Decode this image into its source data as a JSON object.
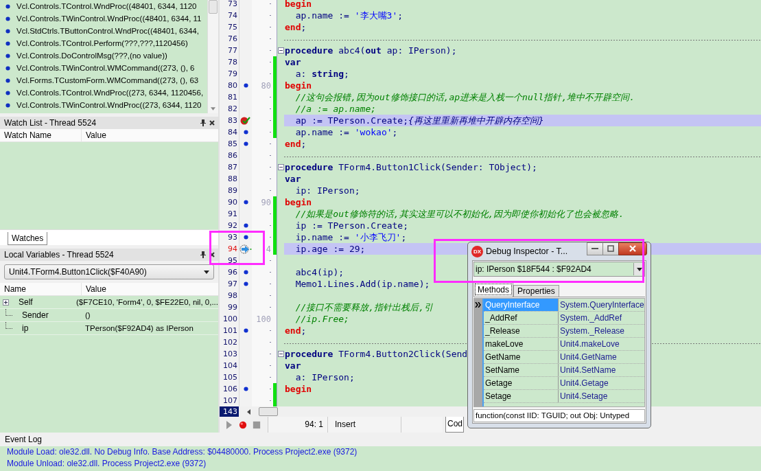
{
  "call_stack": {
    "items": [
      "Vcl.Controls.TControl.WndProc((48401, 6344, 1120",
      "Vcl.Controls.TWinControl.WndProc((48401, 6344, 11",
      "Vcl.StdCtrls.TButtonControl.WndProc((48401, 6344,",
      "Vcl.Controls.TControl.Perform(???,???,1120456)",
      "Vcl.Controls.DoControlMsg(???,(no value))",
      "Vcl.Controls.TWinControl.WMCommand((273, (), 6",
      "Vcl.Forms.TCustomForm.WMCommand((273, (), 63",
      "Vcl.Controls.TControl.WndProc((273, 6344, 1120456,",
      "Vcl.Controls.TWinControl.WndProc((273, 6344, 1120"
    ]
  },
  "watch_list": {
    "title": "Watch List - Thread 5524",
    "columns": [
      "Watch Name",
      "Value"
    ]
  },
  "bottom_tabs": [
    {
      "label": "Watches",
      "selected": true
    }
  ],
  "local_variables": {
    "title": "Local Variables - Thread 5524",
    "frame": "Unit4.TForm4.Button1Click($F40A90)",
    "columns": [
      "Name",
      "Value"
    ],
    "rows": [
      {
        "name": "Self",
        "value": "($F7CE10, 'Form4', 0, $FE22E0, nil, 0,...",
        "expanded": false
      },
      {
        "name": "Sender",
        "value": "()"
      },
      {
        "name": "ip",
        "value": "TPerson($F92AD4) as IPerson"
      }
    ]
  },
  "editor": {
    "lines": [
      {
        "number": "73",
        "modified": false,
        "highlighted": false,
        "tokens": [
          {
            "text": "begin",
            "kind": "block"
          }
        ]
      },
      {
        "number": "74",
        "modified": false,
        "highlighted": false,
        "tokens": [
          {
            "text": "  ap.name := ",
            "kind": "id"
          },
          {
            "text": "'李大嘴3'",
            "kind": "str"
          },
          {
            "text": ";",
            "kind": "id"
          }
        ]
      },
      {
        "number": "75",
        "modified": false,
        "highlighted": false,
        "tokens": [
          {
            "text": "end",
            "kind": "block"
          },
          {
            "text": ";",
            "kind": "id"
          }
        ]
      },
      {
        "number": "76",
        "modified": false,
        "highlighted": false,
        "separator": true
      },
      {
        "number": "77",
        "modified": false,
        "highlighted": false,
        "fold": true,
        "tokens": [
          {
            "text": "procedure",
            "kind": "kw"
          },
          {
            "text": " abc4(",
            "kind": "id"
          },
          {
            "text": "out",
            "kind": "kw"
          },
          {
            "text": " ap: IPerson);",
            "kind": "id"
          }
        ]
      },
      {
        "number": "78",
        "modified": true,
        "highlighted": false,
        "tokens": [
          {
            "text": "var",
            "kind": "kw"
          }
        ]
      },
      {
        "number": "79",
        "modified": true,
        "highlighted": false,
        "tokens": [
          {
            "text": "  a: ",
            "kind": "id"
          },
          {
            "text": "string",
            "kind": "kw"
          },
          {
            "text": ";",
            "kind": "id"
          }
        ]
      },
      {
        "number": "80",
        "marker": {
          "kind": "dot"
        },
        "mark": "80",
        "modified": true,
        "highlighted": false,
        "tokens": [
          {
            "text": "begin",
            "kind": "block"
          }
        ]
      },
      {
        "number": "81",
        "modified": true,
        "highlighted": false,
        "tokens": [
          {
            "text": "  //这句会报错,因为out修饰接口的话,ap进来是入栈一个null指针,堆中不开辟空间.",
            "kind": "cmt"
          }
        ]
      },
      {
        "number": "82",
        "modified": true,
        "highlighted": false,
        "tokens": [
          {
            "text": "  //a := ap.name;",
            "kind": "cmt"
          }
        ]
      },
      {
        "number": "83",
        "marker": {
          "kind": "check"
        },
        "modified": true,
        "highlighted": true,
        "tokens": [
          {
            "text": "  ap := TPerson.Create;",
            "kind": "id"
          },
          {
            "text": "{再这里重新再堆中开辟内存空间}",
            "kind": "note"
          }
        ]
      },
      {
        "number": "84",
        "marker": {
          "kind": "dot"
        },
        "modified": true,
        "highlighted": false,
        "tokens": [
          {
            "text": "  ap.name := ",
            "kind": "id"
          },
          {
            "text": "'wokao'",
            "kind": "str"
          },
          {
            "text": ";",
            "kind": "id"
          }
        ]
      },
      {
        "number": "85",
        "marker": {
          "kind": "dot"
        },
        "modified": false,
        "highlighted": false,
        "tokens": [
          {
            "text": "end",
            "kind": "block"
          },
          {
            "text": ";",
            "kind": "id"
          }
        ]
      },
      {
        "number": "86",
        "modified": false,
        "highlighted": false,
        "separator": true
      },
      {
        "number": "87",
        "modified": false,
        "highlighted": false,
        "fold": true,
        "tokens": [
          {
            "text": "procedure",
            "kind": "kw"
          },
          {
            "text": " TForm4.Button1Click(Sender: TObject);",
            "kind": "id"
          }
        ]
      },
      {
        "number": "88",
        "modified": false,
        "highlighted": false,
        "tokens": [
          {
            "text": "var",
            "kind": "kw"
          }
        ]
      },
      {
        "number": "89",
        "modified": false,
        "highlighted": false,
        "tokens": [
          {
            "text": "  ip: IPerson;",
            "kind": "id"
          }
        ]
      },
      {
        "number": "90",
        "marker": {
          "kind": "dot"
        },
        "mark": "90",
        "modified": true,
        "highlighted": false,
        "tokens": [
          {
            "text": "begin",
            "kind": "block"
          }
        ]
      },
      {
        "number": "91",
        "modified": true,
        "highlighted": false,
        "tokens": [
          {
            "text": "  //如果是out修饰符的话,其实这里可以不初始化,因为即使你初始化了也会被忽略.",
            "kind": "cmt"
          }
        ]
      },
      {
        "number": "92",
        "marker": {
          "kind": "dot"
        },
        "modified": true,
        "highlighted": false,
        "tokens": [
          {
            "text": "  ip := TPerson.Create;",
            "kind": "id"
          }
        ]
      },
      {
        "number": "93",
        "marker": {
          "kind": "dot"
        },
        "modified": true,
        "highlighted": false,
        "tokens": [
          {
            "text": "  ip.name := ",
            "kind": "id"
          },
          {
            "text": "'小李飞刀'",
            "kind": "str"
          },
          {
            "text": ";",
            "kind": "id"
          }
        ]
      },
      {
        "number": "94",
        "marker": {
          "kind": "arrow"
        },
        "mark": "4",
        "modified": true,
        "highlighted": true,
        "tokens": [
          {
            "text": "  ip.age := ",
            "kind": "id"
          },
          {
            "text": "29",
            "kind": "num"
          },
          {
            "text": ";",
            "kind": "id"
          }
        ]
      },
      {
        "number": "95",
        "modified": false,
        "highlighted": false
      },
      {
        "number": "96",
        "marker": {
          "kind": "dot"
        },
        "modified": false,
        "highlighted": false,
        "tokens": [
          {
            "text": "  abc4(ip);",
            "kind": "id"
          }
        ]
      },
      {
        "number": "97",
        "marker": {
          "kind": "dot"
        },
        "modified": false,
        "highlighted": false,
        "tokens": [
          {
            "text": "  Memo1.Lines.Add(ip.name);",
            "kind": "id"
          }
        ]
      },
      {
        "number": "98",
        "modified": false,
        "highlighted": false
      },
      {
        "number": "99",
        "modified": false,
        "highlighted": false,
        "tokens": [
          {
            "text": "  //接口不需要释放,指针出栈后,引",
            "kind": "cmt"
          }
        ]
      },
      {
        "number": "100",
        "mark": "100",
        "modified": false,
        "highlighted": false,
        "tokens": [
          {
            "text": "  //ip.Free;",
            "kind": "cmt"
          }
        ]
      },
      {
        "number": "101",
        "marker": {
          "kind": "dot"
        },
        "modified": false,
        "highlighted": false,
        "tokens": [
          {
            "text": "end",
            "kind": "block"
          },
          {
            "text": ";",
            "kind": "id"
          }
        ]
      },
      {
        "number": "102",
        "modified": false,
        "highlighted": false,
        "separator": true
      },
      {
        "number": "103",
        "modified": false,
        "highlighted": false,
        "fold": true,
        "tokens": [
          {
            "text": "procedure",
            "kind": "kw"
          },
          {
            "text": " TForm4.Button2Click(Send",
            "kind": "id"
          }
        ]
      },
      {
        "number": "104",
        "modified": false,
        "highlighted": false,
        "tokens": [
          {
            "text": "var",
            "kind": "kw"
          }
        ]
      },
      {
        "number": "105",
        "modified": false,
        "highlighted": false,
        "tokens": [
          {
            "text": "  a: IPerson;",
            "kind": "id"
          }
        ]
      },
      {
        "number": "106",
        "marker": {
          "kind": "dot"
        },
        "modified": true,
        "highlighted": false,
        "tokens": [
          {
            "text": "begin",
            "kind": "block"
          }
        ]
      },
      {
        "number": "107",
        "modified": true,
        "highlighted": false
      }
    ],
    "line_count": "143",
    "status": {
      "position": "94: 1",
      "mode": "Insert"
    },
    "tabs": [
      {
        "label": "Cod",
        "selected": true
      }
    ]
  },
  "debug_inspector": {
    "logo": "DX",
    "title": "Debug Inspector - T...",
    "expression": "ip: IPerson $18F544 : $F92AD4",
    "tabs": [
      {
        "label": "Methods",
        "selected": true
      },
      {
        "label": "Properties",
        "selected": false
      }
    ],
    "rows": [
      {
        "name": "QueryInterface",
        "value": "System.QueryInterface",
        "selected": true
      },
      {
        "name": "_AddRef",
        "value": "System._AddRef",
        "selected": false
      },
      {
        "name": "_Release",
        "value": "System._Release",
        "selected": false
      },
      {
        "name": "makeLove",
        "value": "Unit4.makeLove",
        "selected": false
      },
      {
        "name": "GetName",
        "value": "Unit4.GetName",
        "selected": false
      },
      {
        "name": "SetName",
        "value": "Unit4.SetName",
        "selected": false
      },
      {
        "name": "Getage",
        "value": "Unit4.Getage",
        "selected": false
      },
      {
        "name": "Setage",
        "value": "Unit4.Setage",
        "selected": false
      }
    ],
    "status": "function(const IID: TGUID; out Obj: Untyped"
  },
  "event_log": {
    "title": "Event Log",
    "lines": [
      "Module Load: ole32.dll. No Debug Info. Base Address: $04480000. Process Project2.exe (9372)",
      "Module Unload: ole32.dll. Process Project2.exe (9372)"
    ]
  }
}
